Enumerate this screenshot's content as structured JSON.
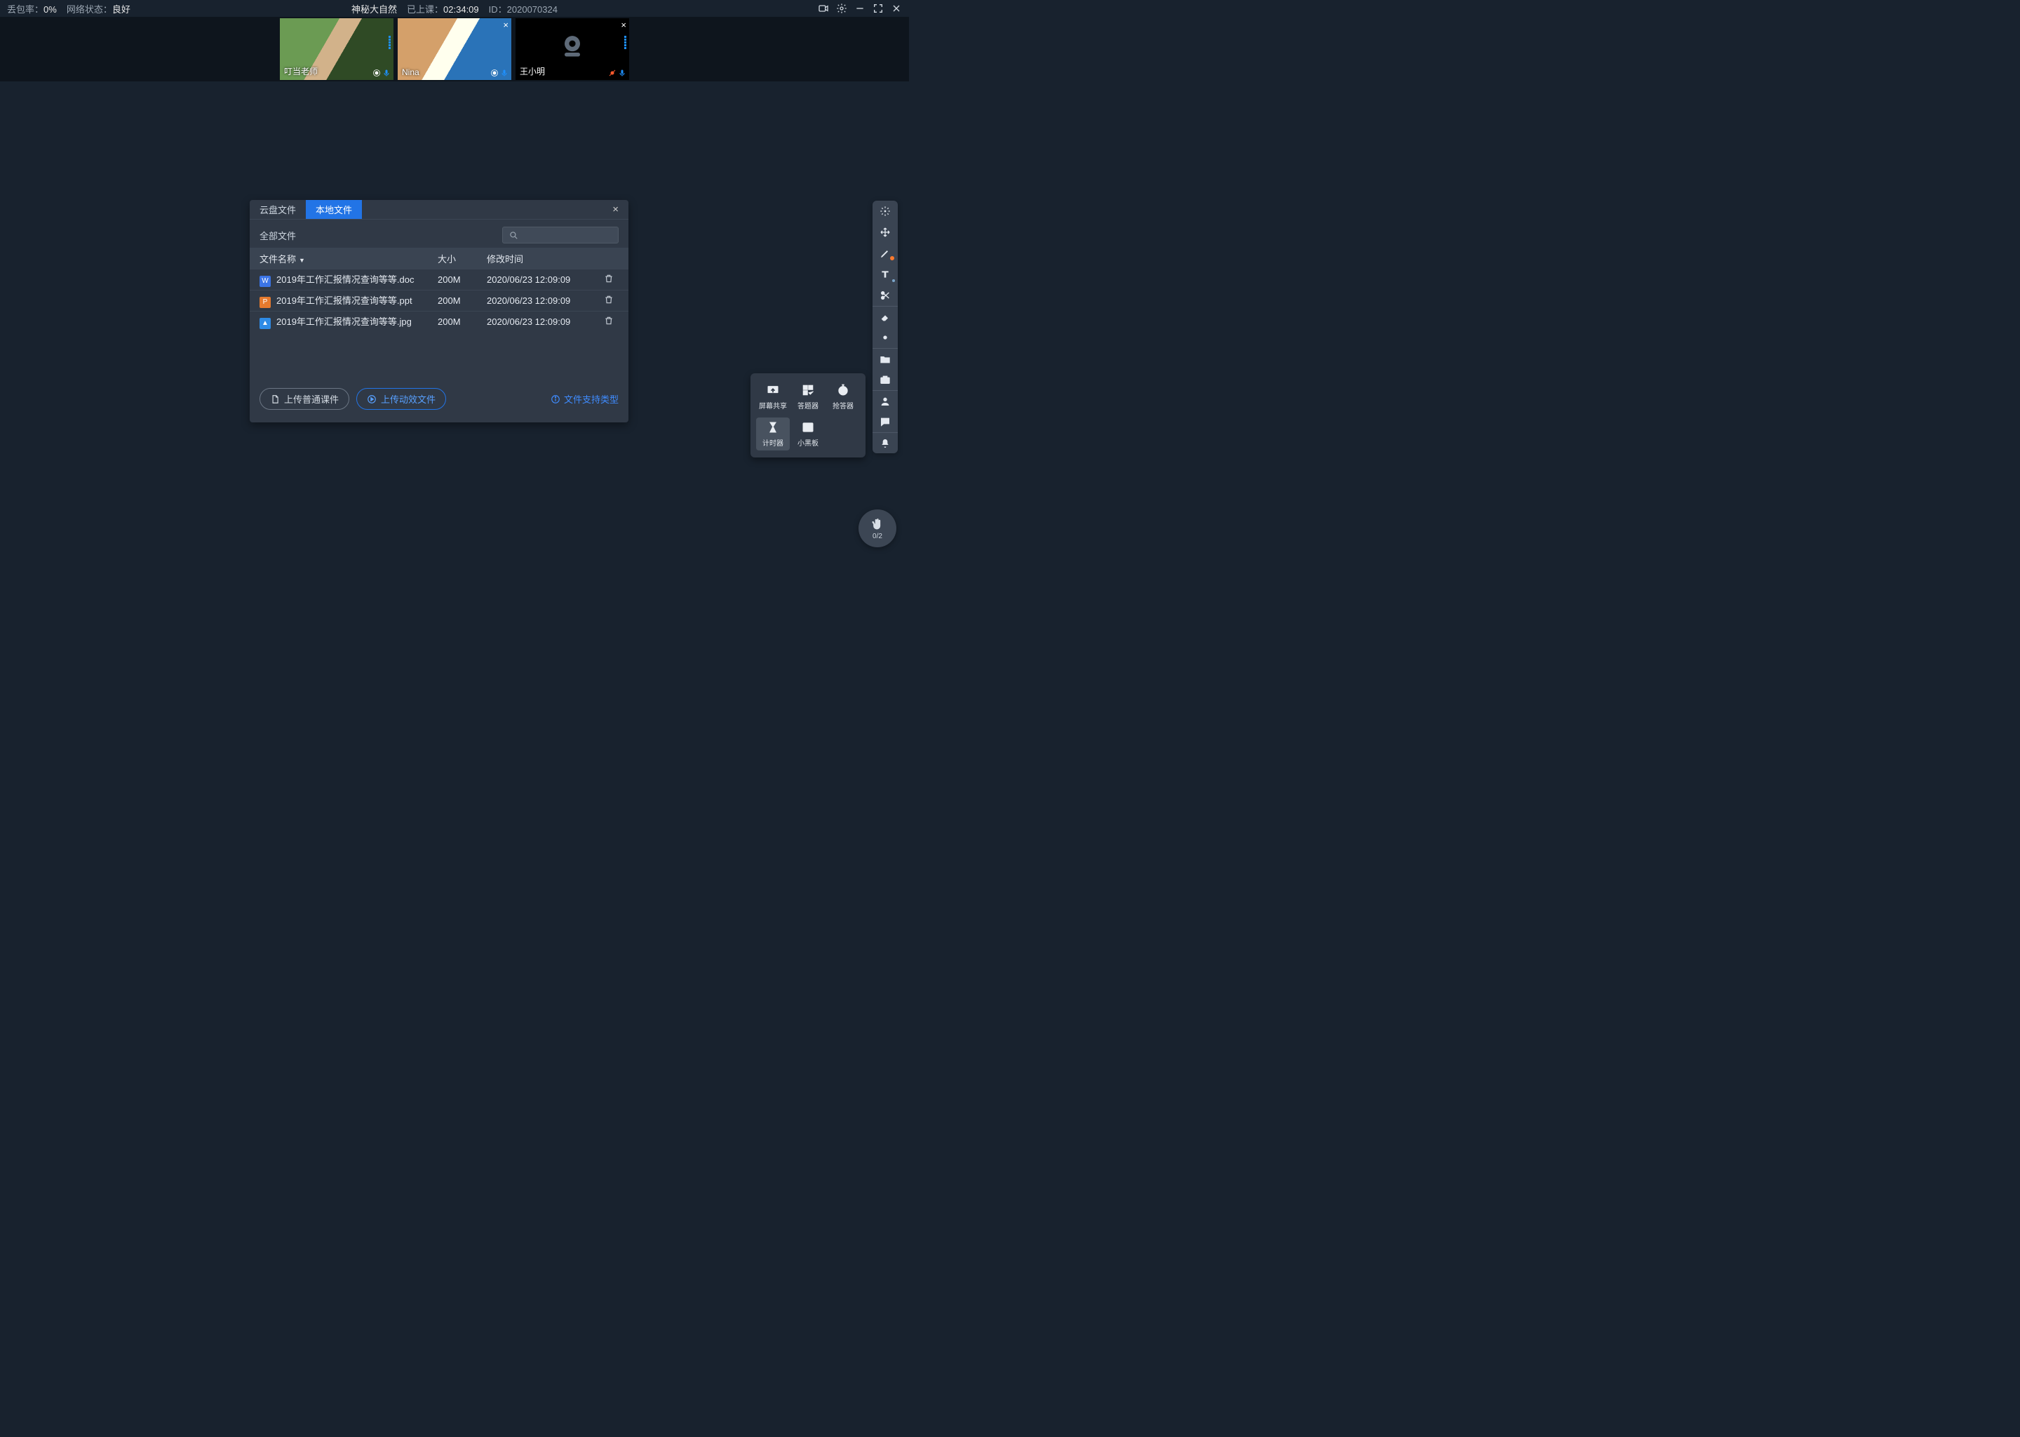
{
  "topbar": {
    "packet_loss_label": "丢包率：",
    "packet_loss_value": "0%",
    "net_label": "网络状态：",
    "net_value": "良好",
    "course_title": "神秘大自然",
    "duration_label": "已上课：",
    "duration_value": "02:34:09",
    "id_label": "ID：",
    "id_value": "2020070324"
  },
  "cams": [
    {
      "name": "叮当老师",
      "off": false,
      "closeable": false,
      "muted": false
    },
    {
      "name": "Nina",
      "off": false,
      "closeable": true,
      "muted": false
    },
    {
      "name": "王小明",
      "off": true,
      "closeable": true,
      "muted": true
    }
  ],
  "dialog": {
    "tabs": [
      "云盘文件",
      "本地文件"
    ],
    "active": 1,
    "scope": "全部文件",
    "cols": {
      "name": "文件名称",
      "size": "大小",
      "date": "修改时间"
    },
    "rows": [
      {
        "icon": "w",
        "name": "2019年工作汇报情况查询等等.doc",
        "size": "200M",
        "date": "2020/06/23 12:09:09"
      },
      {
        "icon": "p",
        "name": "2019年工作汇报情况查询等等.ppt",
        "size": "200M",
        "date": "2020/06/23 12:09:09"
      },
      {
        "icon": "i",
        "name": "2019年工作汇报情况查询等等.jpg",
        "size": "200M",
        "date": "2020/06/23 12:09:09"
      }
    ],
    "btn_upload_normal": "上传普通课件",
    "btn_upload_anim": "上传动效文件",
    "support_text": "文件支持类型"
  },
  "popup": {
    "screen_share": "屏幕共享",
    "answer": "答题器",
    "responder": "抢答器",
    "timer": "计时器",
    "board": "小黑板"
  },
  "fab": {
    "count": "0/2"
  }
}
